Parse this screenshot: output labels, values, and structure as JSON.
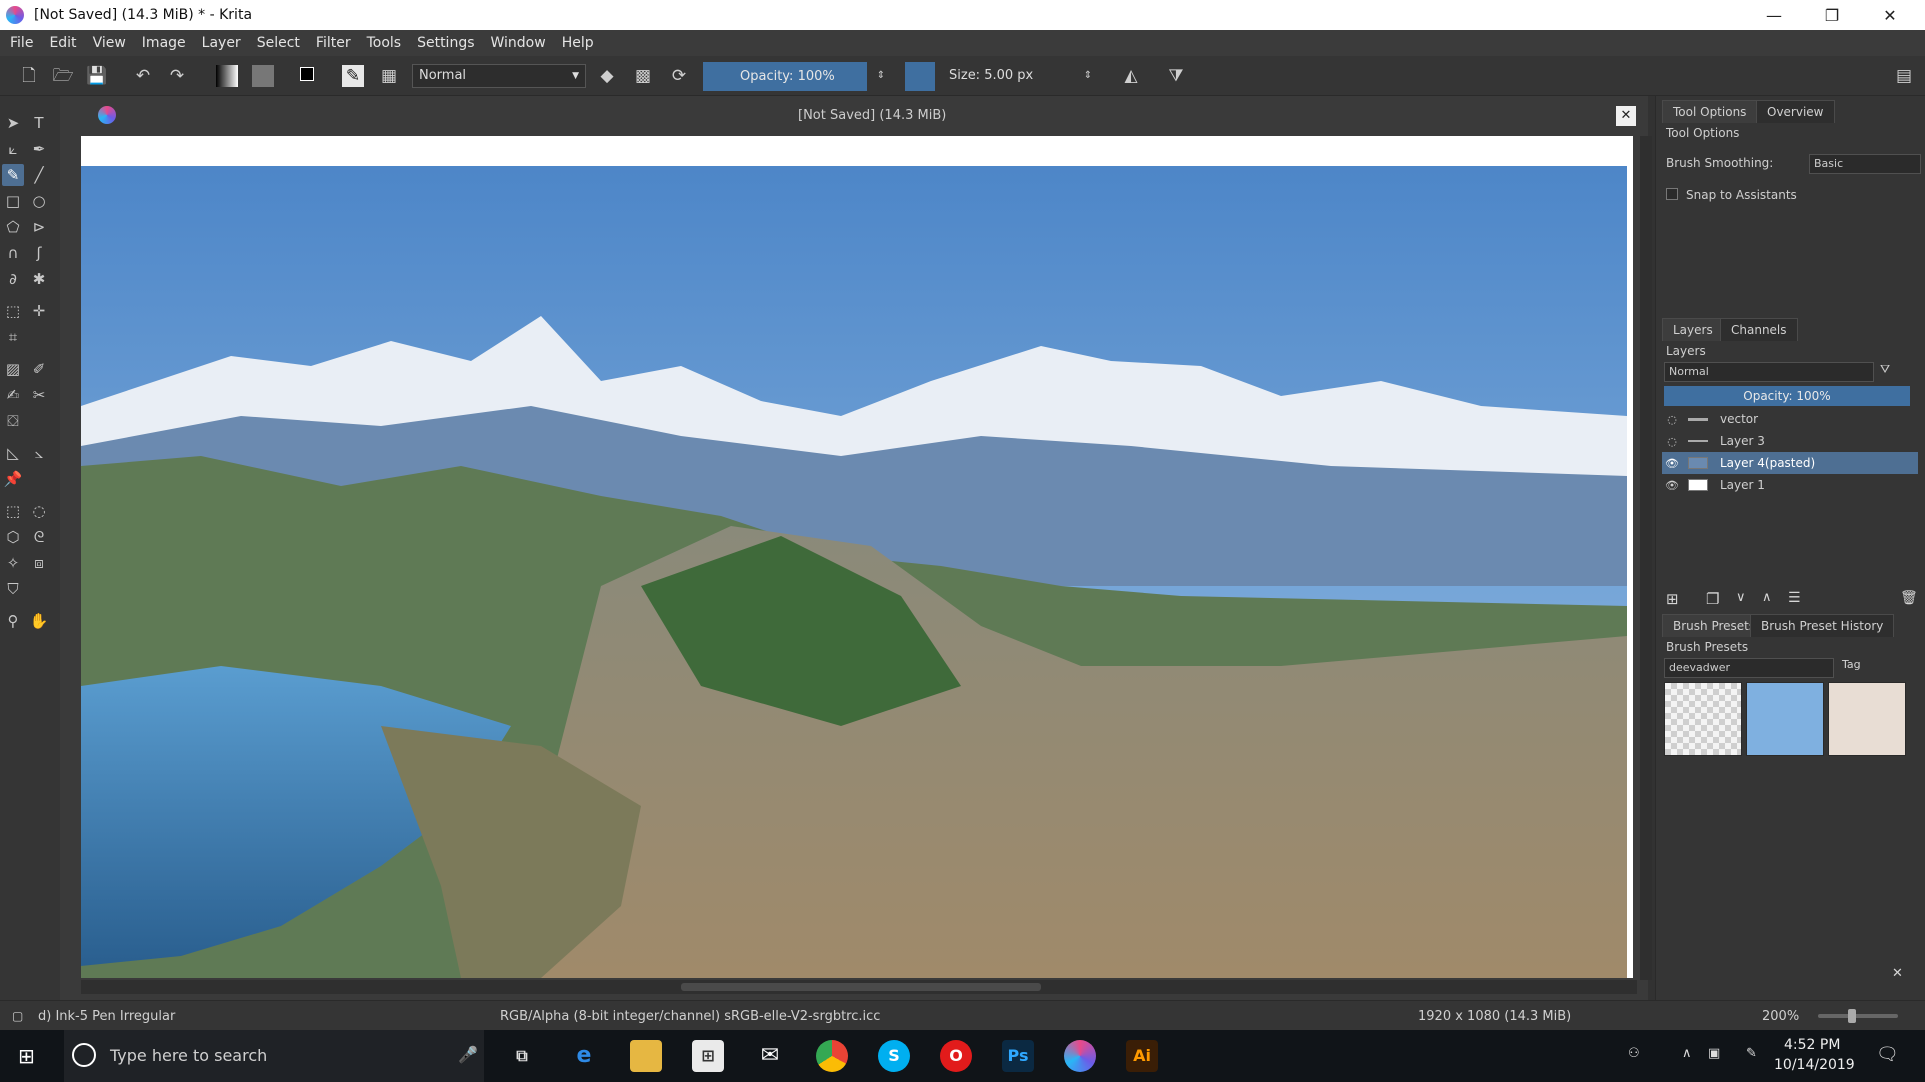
{
  "window": {
    "title": "[Not Saved]  (14.3 MiB) * - Krita",
    "controls": [
      "—",
      "❐",
      "✕"
    ]
  },
  "menu": [
    "File",
    "Edit",
    "View",
    "Image",
    "Layer",
    "Select",
    "Filter",
    "Tools",
    "Settings",
    "Window",
    "Help"
  ],
  "toolbar": {
    "blend_mode": "Normal",
    "opacity": "Opacity:  100%",
    "size": "Size:  5.00 px"
  },
  "document": {
    "tab_title": "[Not Saved]  (14.3 MiB)"
  },
  "tool_options": {
    "tabs": [
      "Tool Options",
      "Overview"
    ],
    "header": "Tool Options",
    "brush_smoothing_label": "Brush Smoothing:",
    "brush_smoothing_value": "Basic",
    "snap_label": "Snap to Assistants"
  },
  "layers_panel": {
    "tabs": [
      "Layers",
      "Channels"
    ],
    "header": "Layers",
    "blend_mode": "Normal",
    "opacity": "Opacity:  100%",
    "layers": [
      {
        "name": "vector",
        "visible": false,
        "selected": false
      },
      {
        "name": "Layer 3",
        "visible": false,
        "selected": false
      },
      {
        "name": "Layer 4(pasted)",
        "visible": true,
        "selected": true
      },
      {
        "name": "Layer 1",
        "visible": true,
        "selected": false
      }
    ]
  },
  "brush_presets": {
    "tabs": [
      "Brush Presets",
      "Brush Preset History"
    ],
    "header": "Brush Presets",
    "tag_filter": "deevadwer",
    "tag_button": "Tag"
  },
  "status": {
    "brush": "d) Ink-5 Pen Irregular",
    "color_profile": "RGB/Alpha (8-bit integer/channel)  sRGB-elle-V2-srgbtrc.icc",
    "image_size": "1920 x 1080 (14.3 MiB)",
    "zoom": "200%"
  },
  "taskbar": {
    "search_placeholder": "Type here to search",
    "time": "4:52 PM",
    "date": "10/14/2019"
  },
  "colors": {
    "accent": "#4e6f93",
    "panel": "#353535",
    "opacity_slider": "#3f6fa0"
  }
}
